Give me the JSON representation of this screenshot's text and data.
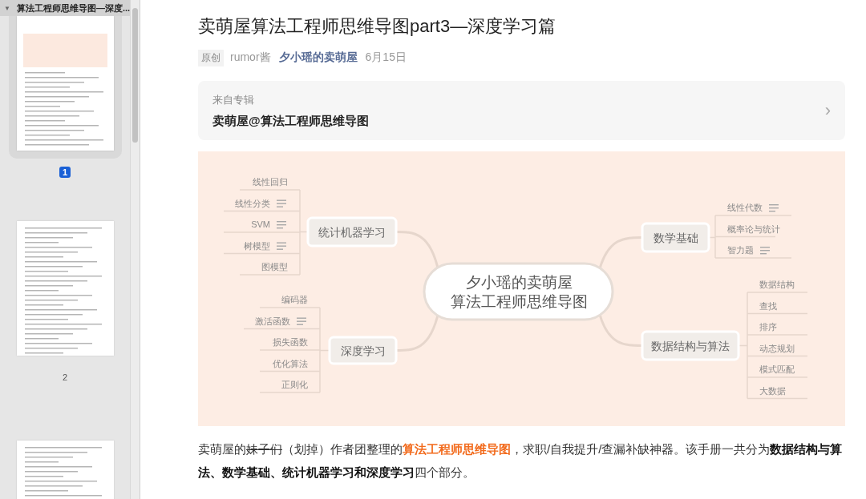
{
  "sidebar": {
    "toggle": "▼",
    "title": "算法工程师思维导图—深度...",
    "pages": [
      {
        "label": "1",
        "selected": true
      },
      {
        "label": "2",
        "selected": false
      },
      {
        "selected": false
      }
    ]
  },
  "article": {
    "title": "卖萌屋算法工程师思维导图part3—深度学习篇",
    "meta": {
      "badge": "原创",
      "author": "rumor酱",
      "account": "夕小瑶的卖萌屋",
      "date": "6月15日"
    },
    "album": {
      "caption": "来自专辑",
      "name": "卖萌屋@算法工程师思维导图",
      "chevron": "›"
    },
    "mind_map": {
      "center": [
        "夕小瑶的卖萌屋",
        "算法工程师思维导图"
      ],
      "branches": [
        {
          "label": "统计机器学习",
          "children": [
            {
              "label": "线性回归",
              "note": false
            },
            {
              "label": "线性分类",
              "note": true
            },
            {
              "label": "SVM",
              "note": true
            },
            {
              "label": "树模型",
              "note": true
            },
            {
              "label": "图模型",
              "note": false
            }
          ]
        },
        {
          "label": "深度学习",
          "children": [
            {
              "label": "编码器",
              "note": false
            },
            {
              "label": "激活函数",
              "note": true
            },
            {
              "label": "损失函数",
              "note": false
            },
            {
              "label": "优化算法",
              "note": false
            },
            {
              "label": "正则化",
              "note": false
            }
          ]
        },
        {
          "label": "数学基础",
          "children": [
            {
              "label": "线性代数",
              "note": true
            },
            {
              "label": "概率论与统计",
              "note": false
            },
            {
              "label": "智力题",
              "note": true
            }
          ]
        },
        {
          "label": "数据结构与算法",
          "children": [
            {
              "label": "数据结构",
              "note": false
            },
            {
              "label": "查找",
              "note": false
            },
            {
              "label": "排序",
              "note": false
            },
            {
              "label": "动态规划",
              "note": false
            },
            {
              "label": "模式匹配",
              "note": false
            },
            {
              "label": "大数据",
              "note": false
            }
          ]
        }
      ]
    },
    "paragraph": [
      {
        "kind": "plain",
        "text": "卖萌屋的"
      },
      {
        "kind": "strike",
        "text": "妹子们"
      },
      {
        "kind": "plain",
        "text": "（划掉）作者团整理的"
      },
      {
        "kind": "highlight",
        "text": "算法工程师思维导图"
      },
      {
        "kind": "plain",
        "text": "，求职/自我提升/查漏补缺神器。该手册一共分为"
      },
      {
        "kind": "bold",
        "text": "数据结构与算法、数学基础、统计机器学习和深度学习"
      },
      {
        "kind": "plain",
        "text": "四个部分。"
      }
    ]
  }
}
